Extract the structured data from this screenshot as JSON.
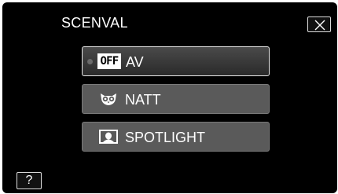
{
  "header": {
    "title": "SCENVAL"
  },
  "options": [
    {
      "label": "AV",
      "badge": "OFF",
      "icon": "off-badge",
      "selected": true
    },
    {
      "label": "NATT",
      "icon": "owl-night-icon",
      "selected": false
    },
    {
      "label": "SPOTLIGHT",
      "icon": "spotlight-portrait-icon",
      "selected": false
    }
  ],
  "controls": {
    "close_icon": "close-icon",
    "help_label": "?"
  },
  "colors": {
    "background": "#000000",
    "button": "#5a5a5a",
    "selected_border": "#e8e8e8",
    "text": "#ffffff"
  }
}
